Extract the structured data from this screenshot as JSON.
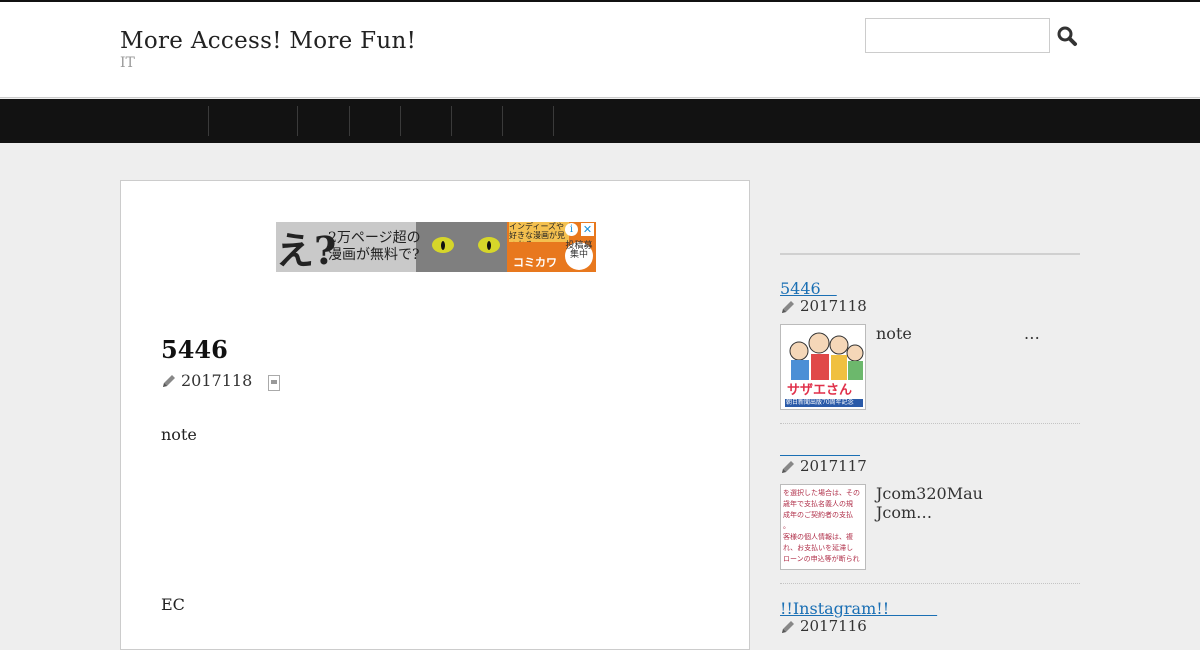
{
  "header": {
    "site_title": "More Access! More Fun!",
    "site_description": "IT",
    "search_placeholder": "",
    "search_icon": "magnifier-icon"
  },
  "nav": {
    "items": [
      "",
      "",
      "",
      "",
      "",
      "",
      ""
    ]
  },
  "ad": {
    "big_text": "え?",
    "line1": "2万ページ超の",
    "line2": "漫画が無料で?",
    "tag": "インディーズや好きな漫画が見つかる",
    "brand": "コミカワ",
    "bubble": "投稿募集中",
    "info": "i",
    "close": "✕"
  },
  "post": {
    "title": "5446",
    "date": "2017118",
    "paragraph1": "note",
    "paragraph2": "EC"
  },
  "sidebar": {
    "entries": [
      {
        "title": "5446　",
        "date": "2017118",
        "excerpt": "note　　　　　　　…",
        "thumb_caption": "サザエさん",
        "thumb_sub": "朝日新聞出版70周年記念"
      },
      {
        "title": "　　　　　",
        "date": "2017117",
        "excerpt": "Jcom320Mau\nJcom…",
        "thumb_lines": [
          "を選択した場合は、その",
          "歳年で支払名義人の規",
          "成年のご契約者の支払",
          "。",
          "客様の個人情報は、複",
          "れ、お支払いを延滞し",
          "ローンの申込等が断られ"
        ]
      },
      {
        "title": "!!Instagram!!　　　",
        "date": "2017116"
      }
    ]
  },
  "colors": {
    "nav_bg": "#121212",
    "link": "#1a6fb4",
    "ad_orange": "#e8781e"
  }
}
